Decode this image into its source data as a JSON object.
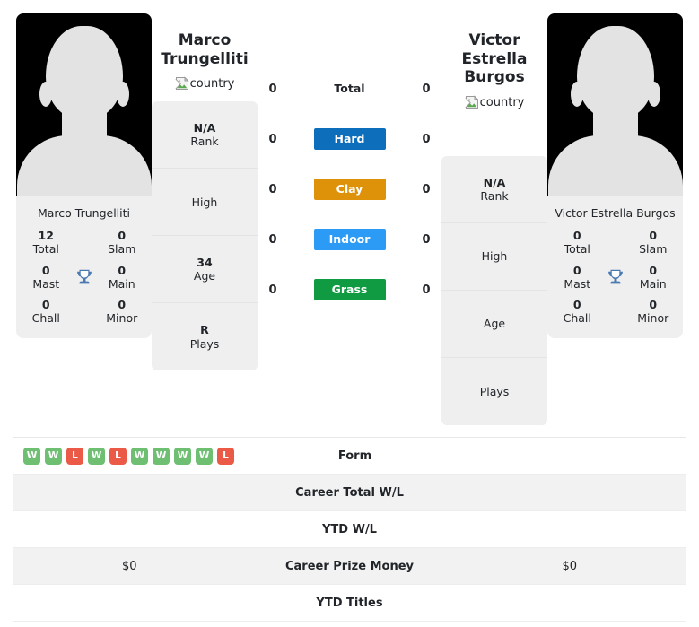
{
  "players": {
    "left": {
      "display_name_line1": "Marco",
      "display_name_line2": "Trungelliti",
      "card_name": "Marco Trungelliti",
      "country_alt": "country",
      "avatar": "player-silhouette",
      "titles": {
        "total_value": "12",
        "total_label": "Total",
        "slam_value": "0",
        "slam_label": "Slam",
        "mast_value": "0",
        "mast_label": "Mast",
        "main_value": "0",
        "main_label": "Main",
        "chall_value": "0",
        "chall_label": "Chall",
        "minor_value": "0",
        "minor_label": "Minor",
        "trophy_icon": "trophy-icon"
      },
      "info": {
        "rank_value": "N/A",
        "rank_label": "Rank",
        "high_value": "",
        "high_label": "High",
        "age_value": "34",
        "age_label": "Age",
        "plays_value": "R",
        "plays_label": "Plays"
      },
      "h2h": {
        "total": "0",
        "hard": "0",
        "clay": "0",
        "indoor": "0",
        "grass": "0"
      },
      "form": [
        "W",
        "W",
        "L",
        "W",
        "L",
        "W",
        "W",
        "W",
        "W",
        "L"
      ],
      "career_total_wl": "",
      "ytd_wl": "",
      "career_prize_money": "$0",
      "ytd_titles": ""
    },
    "right": {
      "display_name_line1": "Victor Estrella",
      "display_name_line2": "Burgos",
      "card_name": "Victor Estrella Burgos",
      "country_alt": "country",
      "avatar": "player-silhouette",
      "titles": {
        "total_value": "0",
        "total_label": "Total",
        "slam_value": "0",
        "slam_label": "Slam",
        "mast_value": "0",
        "mast_label": "Mast",
        "main_value": "0",
        "main_label": "Main",
        "chall_value": "0",
        "chall_label": "Chall",
        "minor_value": "0",
        "minor_label": "Minor",
        "trophy_icon": "trophy-icon"
      },
      "info": {
        "rank_value": "N/A",
        "rank_label": "Rank",
        "high_value": "",
        "high_label": "High",
        "age_value": "",
        "age_label": "Age",
        "plays_value": "",
        "plays_label": "Plays"
      },
      "h2h": {
        "total": "0",
        "hard": "0",
        "clay": "0",
        "indoor": "0",
        "grass": "0"
      },
      "form": [],
      "career_total_wl": "",
      "ytd_wl": "",
      "career_prize_money": "$0",
      "ytd_titles": ""
    }
  },
  "surfaces": [
    {
      "key": "total",
      "label": "Total",
      "color": "",
      "plain": true
    },
    {
      "key": "hard",
      "label": "Hard",
      "color": "#0d6fbc",
      "plain": false
    },
    {
      "key": "clay",
      "label": "Clay",
      "color": "#dd9209",
      "plain": false
    },
    {
      "key": "indoor",
      "label": "Indoor",
      "color": "#2b9bf5",
      "plain": false
    },
    {
      "key": "grass",
      "label": "Grass",
      "color": "#109b42",
      "plain": false
    }
  ],
  "comparison_rows": [
    {
      "key": "form",
      "label": "Form"
    },
    {
      "key": "career_total_wl",
      "label": "Career Total W/L"
    },
    {
      "key": "ytd_wl",
      "label": "YTD W/L"
    },
    {
      "key": "career_prize_money",
      "label": "Career Prize Money"
    },
    {
      "key": "ytd_titles",
      "label": "YTD Titles"
    }
  ],
  "colors": {
    "hard": "#0d6fbc",
    "clay": "#dd9209",
    "indoor": "#2b9bf5",
    "grass": "#109b42",
    "win_badge": "#6fbf73",
    "loss_badge": "#eb5a46",
    "trophy": "#4a7ab0",
    "panel_bg": "#efefef",
    "row_alt_bg": "#f2f2f2"
  }
}
